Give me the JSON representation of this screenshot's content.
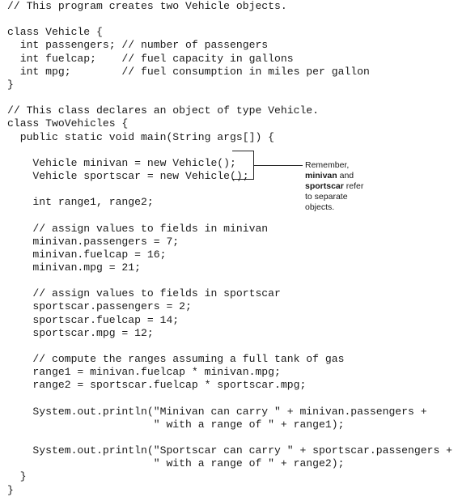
{
  "code_lines": [
    "// This program creates two Vehicle objects.",
    "",
    "class Vehicle {",
    "  int passengers; // number of passengers",
    "  int fuelcap;    // fuel capacity in gallons",
    "  int mpg;        // fuel consumption in miles per gallon",
    "}",
    "",
    "// This class declares an object of type Vehicle.",
    "class TwoVehicles {",
    "  public static void main(String args[]) {",
    "",
    "    Vehicle minivan = new Vehicle();",
    "    Vehicle sportscar = new Vehicle();",
    "",
    "    int range1, range2;",
    "",
    "    // assign values to fields in minivan",
    "    minivan.passengers = 7;",
    "    minivan.fuelcap = 16;",
    "    minivan.mpg = 21;",
    "",
    "    // assign values to fields in sportscar",
    "    sportscar.passengers = 2;",
    "    sportscar.fuelcap = 14;",
    "    sportscar.mpg = 12;",
    "",
    "    // compute the ranges assuming a full tank of gas",
    "    range1 = minivan.fuelcap * minivan.mpg;",
    "    range2 = sportscar.fuelcap * sportscar.mpg;",
    "",
    "    System.out.println(\"Minivan can carry \" + minivan.passengers +",
    "                       \" with a range of \" + range1);",
    "",
    "    System.out.println(\"Sportscar can carry \" + sportscar.passengers +",
    "                       \" with a range of \" + range2);",
    "  }",
    "}"
  ],
  "callout": {
    "line1": "Remember,",
    "line2_bold": "minivan",
    "line2_rest": " and",
    "line3_bold": "sportscar",
    "line3_rest": " refer",
    "line4": "to separate",
    "line5": "objects."
  }
}
